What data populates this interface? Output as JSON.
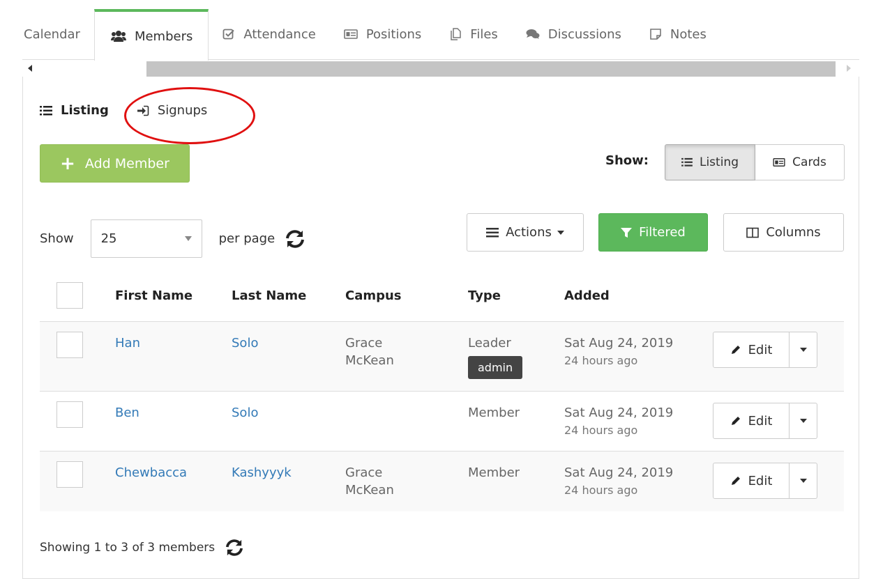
{
  "tabs": [
    {
      "label": "Calendar",
      "icon": ""
    },
    {
      "label": "Members",
      "icon": "users-icon",
      "active": true
    },
    {
      "label": "Attendance",
      "icon": "check-square-icon"
    },
    {
      "label": "Positions",
      "icon": "id-card-icon"
    },
    {
      "label": "Files",
      "icon": "files-icon"
    },
    {
      "label": "Discussions",
      "icon": "comments-icon"
    },
    {
      "label": "Notes",
      "icon": "note-icon"
    }
  ],
  "subnav": {
    "listing": "Listing",
    "signups": "Signups"
  },
  "toolbar": {
    "add_member": "Add Member",
    "show_label": "Show:",
    "view_listing": "Listing",
    "view_cards": "Cards",
    "per_page_prefix": "Show",
    "per_page_value": "25",
    "per_page_suffix": "per page",
    "actions": "Actions",
    "filtered": "Filtered",
    "columns": "Columns"
  },
  "table": {
    "headers": {
      "first_name": "First Name",
      "last_name": "Last Name",
      "campus": "Campus",
      "type": "Type",
      "added": "Added"
    },
    "edit_label": "Edit",
    "rows": [
      {
        "first": "Han",
        "last": "Solo",
        "campus1": "Grace",
        "campus2": "McKean",
        "type": "Leader",
        "badge": "admin",
        "date": "Sat Aug 24, 2019",
        "ago": "24 hours ago"
      },
      {
        "first": "Ben",
        "last": "Solo",
        "campus1": "",
        "campus2": "",
        "type": "Member",
        "badge": "",
        "date": "Sat Aug 24, 2019",
        "ago": "24 hours ago"
      },
      {
        "first": "Chewbacca",
        "last": "Kashyyyk",
        "campus1": "Grace",
        "campus2": "McKean",
        "type": "Member",
        "badge": "",
        "date": "Sat Aug 24, 2019",
        "ago": "24 hours ago"
      }
    ]
  },
  "footer": {
    "summary": "Showing 1 to 3 of 3 members"
  },
  "colors": {
    "active_tab_border": "#5cb85c",
    "add_button": "#9bc75f",
    "filtered_button": "#5cb85c",
    "link": "#337ab7",
    "annotation_circle": "#e01010"
  }
}
